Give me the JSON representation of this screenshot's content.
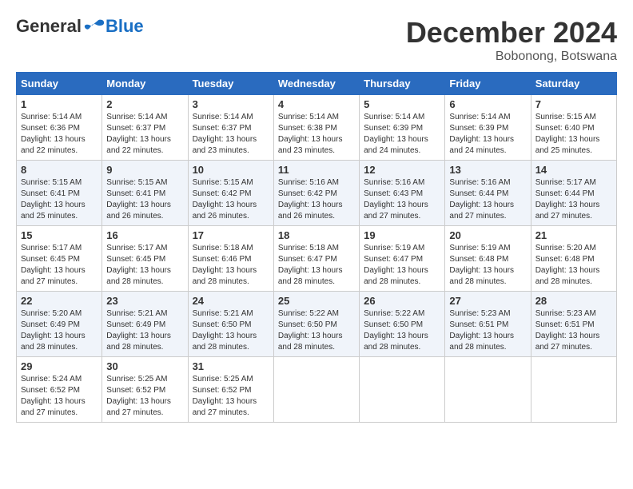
{
  "logo": {
    "general": "General",
    "blue": "Blue"
  },
  "title": "December 2024",
  "location": "Bobonong, Botswana",
  "days_of_week": [
    "Sunday",
    "Monday",
    "Tuesday",
    "Wednesday",
    "Thursday",
    "Friday",
    "Saturday"
  ],
  "weeks": [
    [
      {
        "day": "1",
        "sunrise": "5:14 AM",
        "sunset": "6:36 PM",
        "daylight": "13 hours and 22 minutes."
      },
      {
        "day": "2",
        "sunrise": "5:14 AM",
        "sunset": "6:37 PM",
        "daylight": "13 hours and 22 minutes."
      },
      {
        "day": "3",
        "sunrise": "5:14 AM",
        "sunset": "6:37 PM",
        "daylight": "13 hours and 23 minutes."
      },
      {
        "day": "4",
        "sunrise": "5:14 AM",
        "sunset": "6:38 PM",
        "daylight": "13 hours and 23 minutes."
      },
      {
        "day": "5",
        "sunrise": "5:14 AM",
        "sunset": "6:39 PM",
        "daylight": "13 hours and 24 minutes."
      },
      {
        "day": "6",
        "sunrise": "5:14 AM",
        "sunset": "6:39 PM",
        "daylight": "13 hours and 24 minutes."
      },
      {
        "day": "7",
        "sunrise": "5:15 AM",
        "sunset": "6:40 PM",
        "daylight": "13 hours and 25 minutes."
      }
    ],
    [
      {
        "day": "8",
        "sunrise": "5:15 AM",
        "sunset": "6:41 PM",
        "daylight": "13 hours and 25 minutes."
      },
      {
        "day": "9",
        "sunrise": "5:15 AM",
        "sunset": "6:41 PM",
        "daylight": "13 hours and 26 minutes."
      },
      {
        "day": "10",
        "sunrise": "5:15 AM",
        "sunset": "6:42 PM",
        "daylight": "13 hours and 26 minutes."
      },
      {
        "day": "11",
        "sunrise": "5:16 AM",
        "sunset": "6:42 PM",
        "daylight": "13 hours and 26 minutes."
      },
      {
        "day": "12",
        "sunrise": "5:16 AM",
        "sunset": "6:43 PM",
        "daylight": "13 hours and 27 minutes."
      },
      {
        "day": "13",
        "sunrise": "5:16 AM",
        "sunset": "6:44 PM",
        "daylight": "13 hours and 27 minutes."
      },
      {
        "day": "14",
        "sunrise": "5:17 AM",
        "sunset": "6:44 PM",
        "daylight": "13 hours and 27 minutes."
      }
    ],
    [
      {
        "day": "15",
        "sunrise": "5:17 AM",
        "sunset": "6:45 PM",
        "daylight": "13 hours and 27 minutes."
      },
      {
        "day": "16",
        "sunrise": "5:17 AM",
        "sunset": "6:45 PM",
        "daylight": "13 hours and 28 minutes."
      },
      {
        "day": "17",
        "sunrise": "5:18 AM",
        "sunset": "6:46 PM",
        "daylight": "13 hours and 28 minutes."
      },
      {
        "day": "18",
        "sunrise": "5:18 AM",
        "sunset": "6:47 PM",
        "daylight": "13 hours and 28 minutes."
      },
      {
        "day": "19",
        "sunrise": "5:19 AM",
        "sunset": "6:47 PM",
        "daylight": "13 hours and 28 minutes."
      },
      {
        "day": "20",
        "sunrise": "5:19 AM",
        "sunset": "6:48 PM",
        "daylight": "13 hours and 28 minutes."
      },
      {
        "day": "21",
        "sunrise": "5:20 AM",
        "sunset": "6:48 PM",
        "daylight": "13 hours and 28 minutes."
      }
    ],
    [
      {
        "day": "22",
        "sunrise": "5:20 AM",
        "sunset": "6:49 PM",
        "daylight": "13 hours and 28 minutes."
      },
      {
        "day": "23",
        "sunrise": "5:21 AM",
        "sunset": "6:49 PM",
        "daylight": "13 hours and 28 minutes."
      },
      {
        "day": "24",
        "sunrise": "5:21 AM",
        "sunset": "6:50 PM",
        "daylight": "13 hours and 28 minutes."
      },
      {
        "day": "25",
        "sunrise": "5:22 AM",
        "sunset": "6:50 PM",
        "daylight": "13 hours and 28 minutes."
      },
      {
        "day": "26",
        "sunrise": "5:22 AM",
        "sunset": "6:50 PM",
        "daylight": "13 hours and 28 minutes."
      },
      {
        "day": "27",
        "sunrise": "5:23 AM",
        "sunset": "6:51 PM",
        "daylight": "13 hours and 28 minutes."
      },
      {
        "day": "28",
        "sunrise": "5:23 AM",
        "sunset": "6:51 PM",
        "daylight": "13 hours and 27 minutes."
      }
    ],
    [
      {
        "day": "29",
        "sunrise": "5:24 AM",
        "sunset": "6:52 PM",
        "daylight": "13 hours and 27 minutes."
      },
      {
        "day": "30",
        "sunrise": "5:25 AM",
        "sunset": "6:52 PM",
        "daylight": "13 hours and 27 minutes."
      },
      {
        "day": "31",
        "sunrise": "5:25 AM",
        "sunset": "6:52 PM",
        "daylight": "13 hours and 27 minutes."
      },
      null,
      null,
      null,
      null
    ]
  ],
  "labels": {
    "sunrise": "Sunrise:",
    "sunset": "Sunset:",
    "daylight": "Daylight:"
  }
}
